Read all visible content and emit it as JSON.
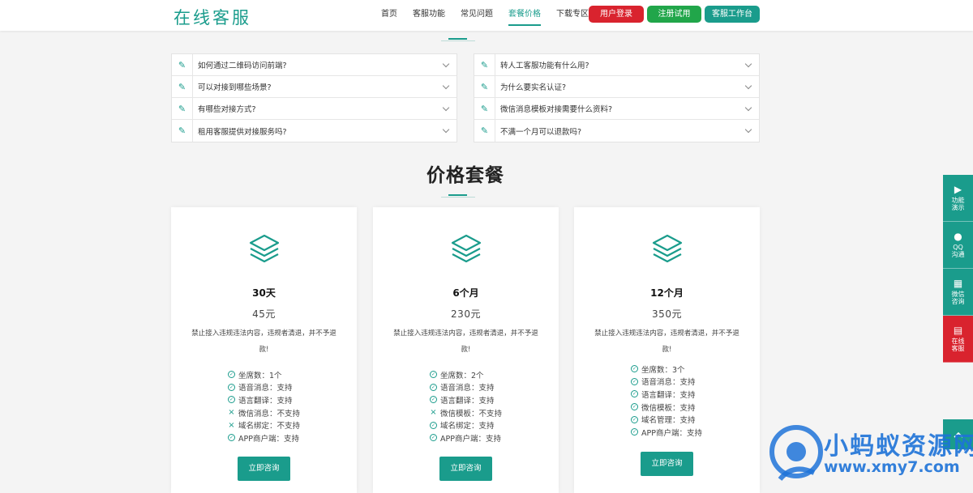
{
  "header": {
    "logo": "在线客服",
    "nav": [
      "首页",
      "客服功能",
      "常见问题",
      "套餐价格",
      "下载专区"
    ],
    "nav_active_index": 3,
    "buttons": {
      "login": "用户登录",
      "register": "注册试用",
      "workbench": "客服工作台"
    }
  },
  "faq": {
    "left": [
      "如何通过二维码访问前端?",
      "可以对接到哪些场景?",
      "有哪些对接方式?",
      "租用客服提供对接服务吗?"
    ],
    "right": [
      "转人工客服功能有什么用?",
      " 为什么要实名认证?",
      "微信消息模板对接需要什么资料?",
      "不满一个月可以退款吗?"
    ]
  },
  "pricing": {
    "title": "价格套餐",
    "plans": [
      {
        "name": "30天",
        "price": "45元",
        "desc": "禁止接入违规违法内容，违规者清退，并不予退款!",
        "features": [
          {
            "text": "坐席数：1个",
            "ok": true
          },
          {
            "text": "语音消息：支持",
            "ok": true
          },
          {
            "text": "语言翻译：支持",
            "ok": true
          },
          {
            "text": "微信消息：不支持",
            "ok": false
          },
          {
            "text": "域名绑定：不支持",
            "ok": false
          },
          {
            "text": "APP商户端：支持",
            "ok": true
          }
        ],
        "button": "立即咨询"
      },
      {
        "name": "6个月",
        "price": "230元",
        "desc": "禁止接入违规违法内容，违规者清退，并不予退款!",
        "features": [
          {
            "text": "坐席数：2个",
            "ok": true
          },
          {
            "text": "语音消息：支持",
            "ok": true
          },
          {
            "text": "语言翻译：支持",
            "ok": true
          },
          {
            "text": "微信模板：不支持",
            "ok": false
          },
          {
            "text": "域名绑定：支持",
            "ok": true
          },
          {
            "text": "APP商户端：支持",
            "ok": true
          }
        ],
        "button": "立即咨询"
      },
      {
        "name": "12个月",
        "price": "350元",
        "desc": "禁止接入违规违法内容，违规者清退，并不予退款!",
        "features": [
          {
            "text": "坐席数：3个",
            "ok": true
          },
          {
            "text": "语音消息：支持",
            "ok": true
          },
          {
            "text": "语言翻译：支持",
            "ok": true
          },
          {
            "text": "微信模板：支持",
            "ok": true
          },
          {
            "text": "域名管理：支持",
            "ok": true
          },
          {
            "text": "APP商户端：支持",
            "ok": true
          }
        ],
        "button": "立即咨询"
      }
    ]
  },
  "float_bar": [
    {
      "label": "功能演示",
      "icon": "play-icon"
    },
    {
      "label": "QQ沟通",
      "icon": "qq-icon"
    },
    {
      "label": "微信咨询",
      "icon": "qrcode-icon"
    },
    {
      "label": "在线客服",
      "icon": "chat-icon"
    }
  ],
  "watermark": {
    "line1": "小蚂蚁资源网",
    "line2": "www.xmy7.com"
  },
  "colors": {
    "accent": "#1a9c8c",
    "red": "#d9232e",
    "green": "#21a64a",
    "watermark": "#1e73d8"
  }
}
